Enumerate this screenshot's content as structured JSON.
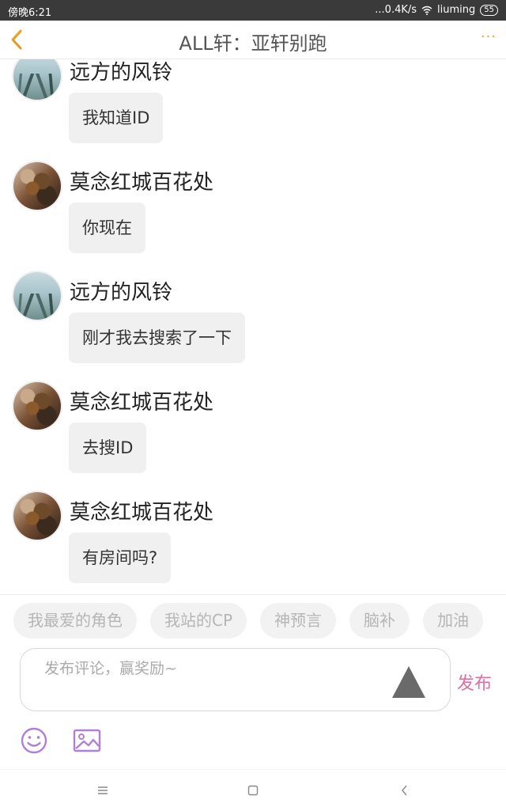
{
  "status_bar": {
    "time": "傍晚6:21",
    "network_speed": "...0.4K/s",
    "wifi_name": "liuming",
    "battery": "55"
  },
  "header": {
    "title": "ALL轩：亚轩别跑"
  },
  "messages": [
    {
      "sender": "远方的风铃",
      "text": "我知道ID",
      "avatar": "mist"
    },
    {
      "sender": "莫念红城百花处",
      "text": "你现在",
      "avatar": "flower"
    },
    {
      "sender": "远方的风铃",
      "text": "刚才我去搜索了一下",
      "avatar": "mist"
    },
    {
      "sender": "莫念红城百花处",
      "text": "去搜ID",
      "avatar": "flower"
    },
    {
      "sender": "莫念红城百花处",
      "text": "有房间吗?",
      "avatar": "flower"
    }
  ],
  "quick_tags": [
    "我最爱的角色",
    "我站的CP",
    "神预言",
    "脑补",
    "加油"
  ],
  "comment": {
    "placeholder": "发布评论，赢奖励~",
    "value": "",
    "publish_label": "发布"
  },
  "colors": {
    "accent_orange": "#f5a623",
    "publish_pink": "#e06fa0",
    "icon_purple": "#b07fd8",
    "bubble_bg": "#f0f0f0"
  }
}
